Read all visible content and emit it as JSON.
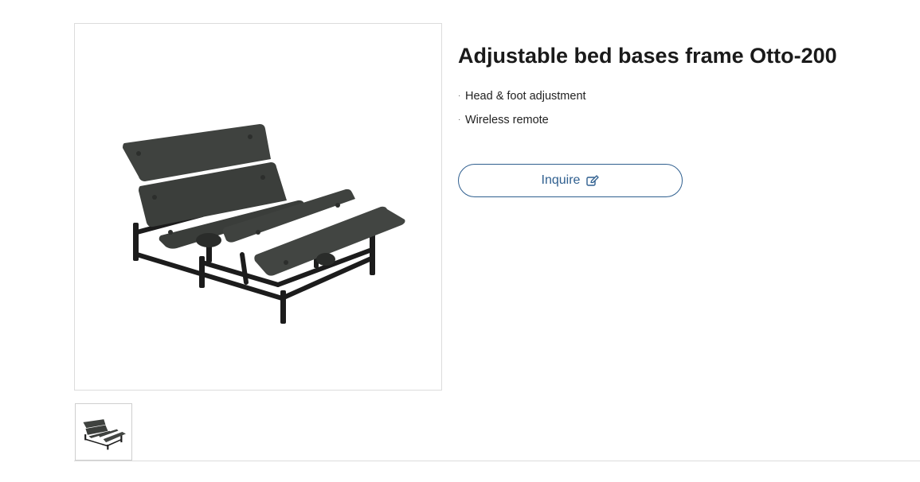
{
  "product": {
    "title": "Adjustable bed bases frame Otto-200",
    "features": [
      "Head & foot adjustment",
      "Wireless remote"
    ],
    "inquire_label": "Inquire",
    "inquire_icon": "edit-icon"
  },
  "gallery": {
    "main_image": "adjustable-bed-frame-image",
    "thumbnails": [
      "adjustable-bed-frame-thumbnail"
    ]
  },
  "colors": {
    "accent": "#2f5f8f",
    "panel": "#3f423f",
    "frame": "#1c1c1c",
    "border": "#dcdcdc"
  }
}
